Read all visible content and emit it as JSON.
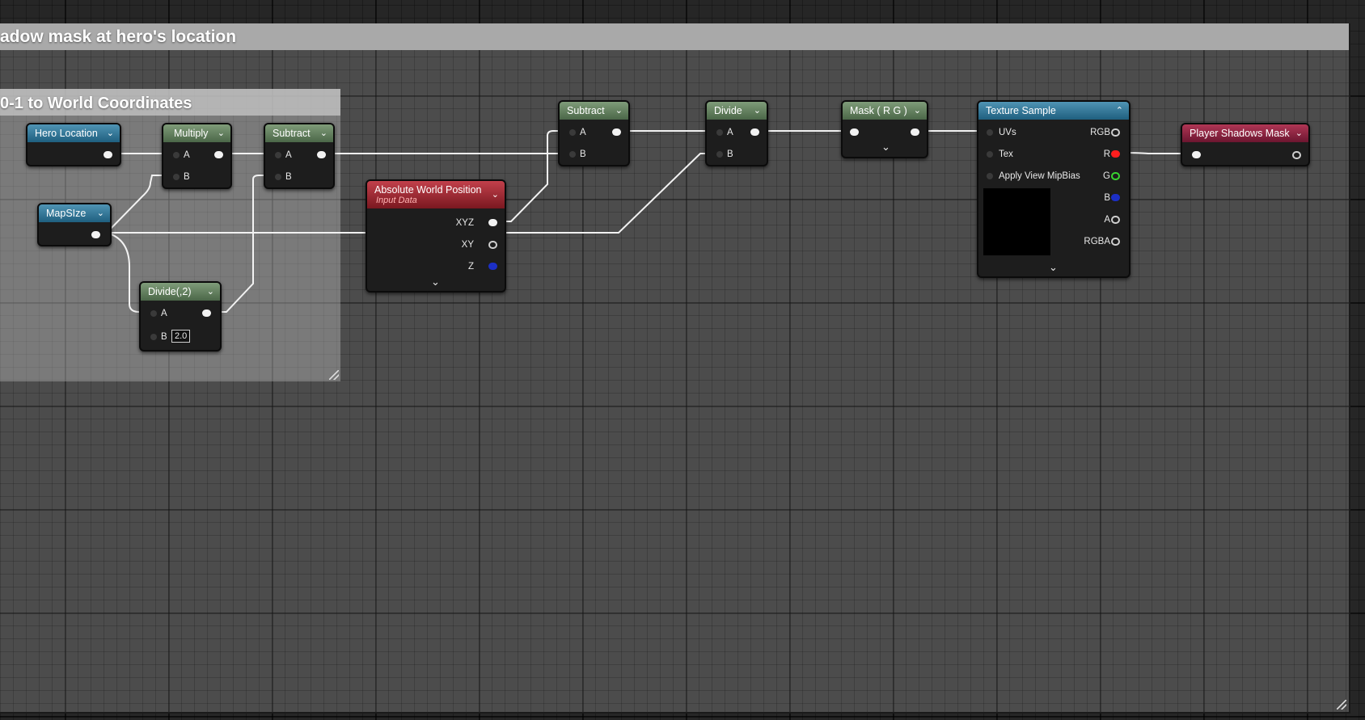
{
  "comments": {
    "outer_title": "adow mask at hero's location",
    "inner_title": "0-1 to World Coordinates"
  },
  "nodes": {
    "hero_location": {
      "title": "Hero Location"
    },
    "mapsize": {
      "title": "MapSIze"
    },
    "multiply": {
      "title": "Multiply",
      "pin_a": "A",
      "pin_b": "B"
    },
    "subtract1": {
      "title": "Subtract",
      "pin_a": "A",
      "pin_b": "B"
    },
    "divide_half": {
      "title": "Divide(,2)",
      "pin_a": "A",
      "pin_b": "B",
      "b_value": "2.0"
    },
    "abs_world_pos": {
      "title": "Absolute World Position",
      "subtitle": "Input Data",
      "pin_xyz": "XYZ",
      "pin_xy": "XY",
      "pin_z": "Z"
    },
    "subtract2": {
      "title": "Subtract",
      "pin_a": "A",
      "pin_b": "B"
    },
    "divide": {
      "title": "Divide",
      "pin_a": "A",
      "pin_b": "B"
    },
    "mask_rg": {
      "title": "Mask ( R G )"
    },
    "texture_sample": {
      "title": "Texture Sample",
      "inputs": [
        "UVs",
        "Tex",
        "Apply View MipBias"
      ],
      "outputs": [
        "RGB",
        "R",
        "G",
        "B",
        "A",
        "RGBA"
      ]
    },
    "player_shadows_mask": {
      "title": "Player Shadows Mask"
    }
  },
  "icons": {
    "dropdown": "chevron-down-icon",
    "collapse": "chevron-up-icon",
    "expand": "chevron-down-icon",
    "resize": "resize-grip-icon"
  },
  "colors": {
    "graph_bg": "#262626",
    "header_parameter": "#2f7391",
    "header_math": "#5d7b59",
    "header_input": "#a02a35",
    "header_output": "#8d2243",
    "wire": "#f2f2f2",
    "pin_r": "#ff1e1e",
    "pin_g": "#39d631",
    "pin_b": "#1c2fc5"
  }
}
